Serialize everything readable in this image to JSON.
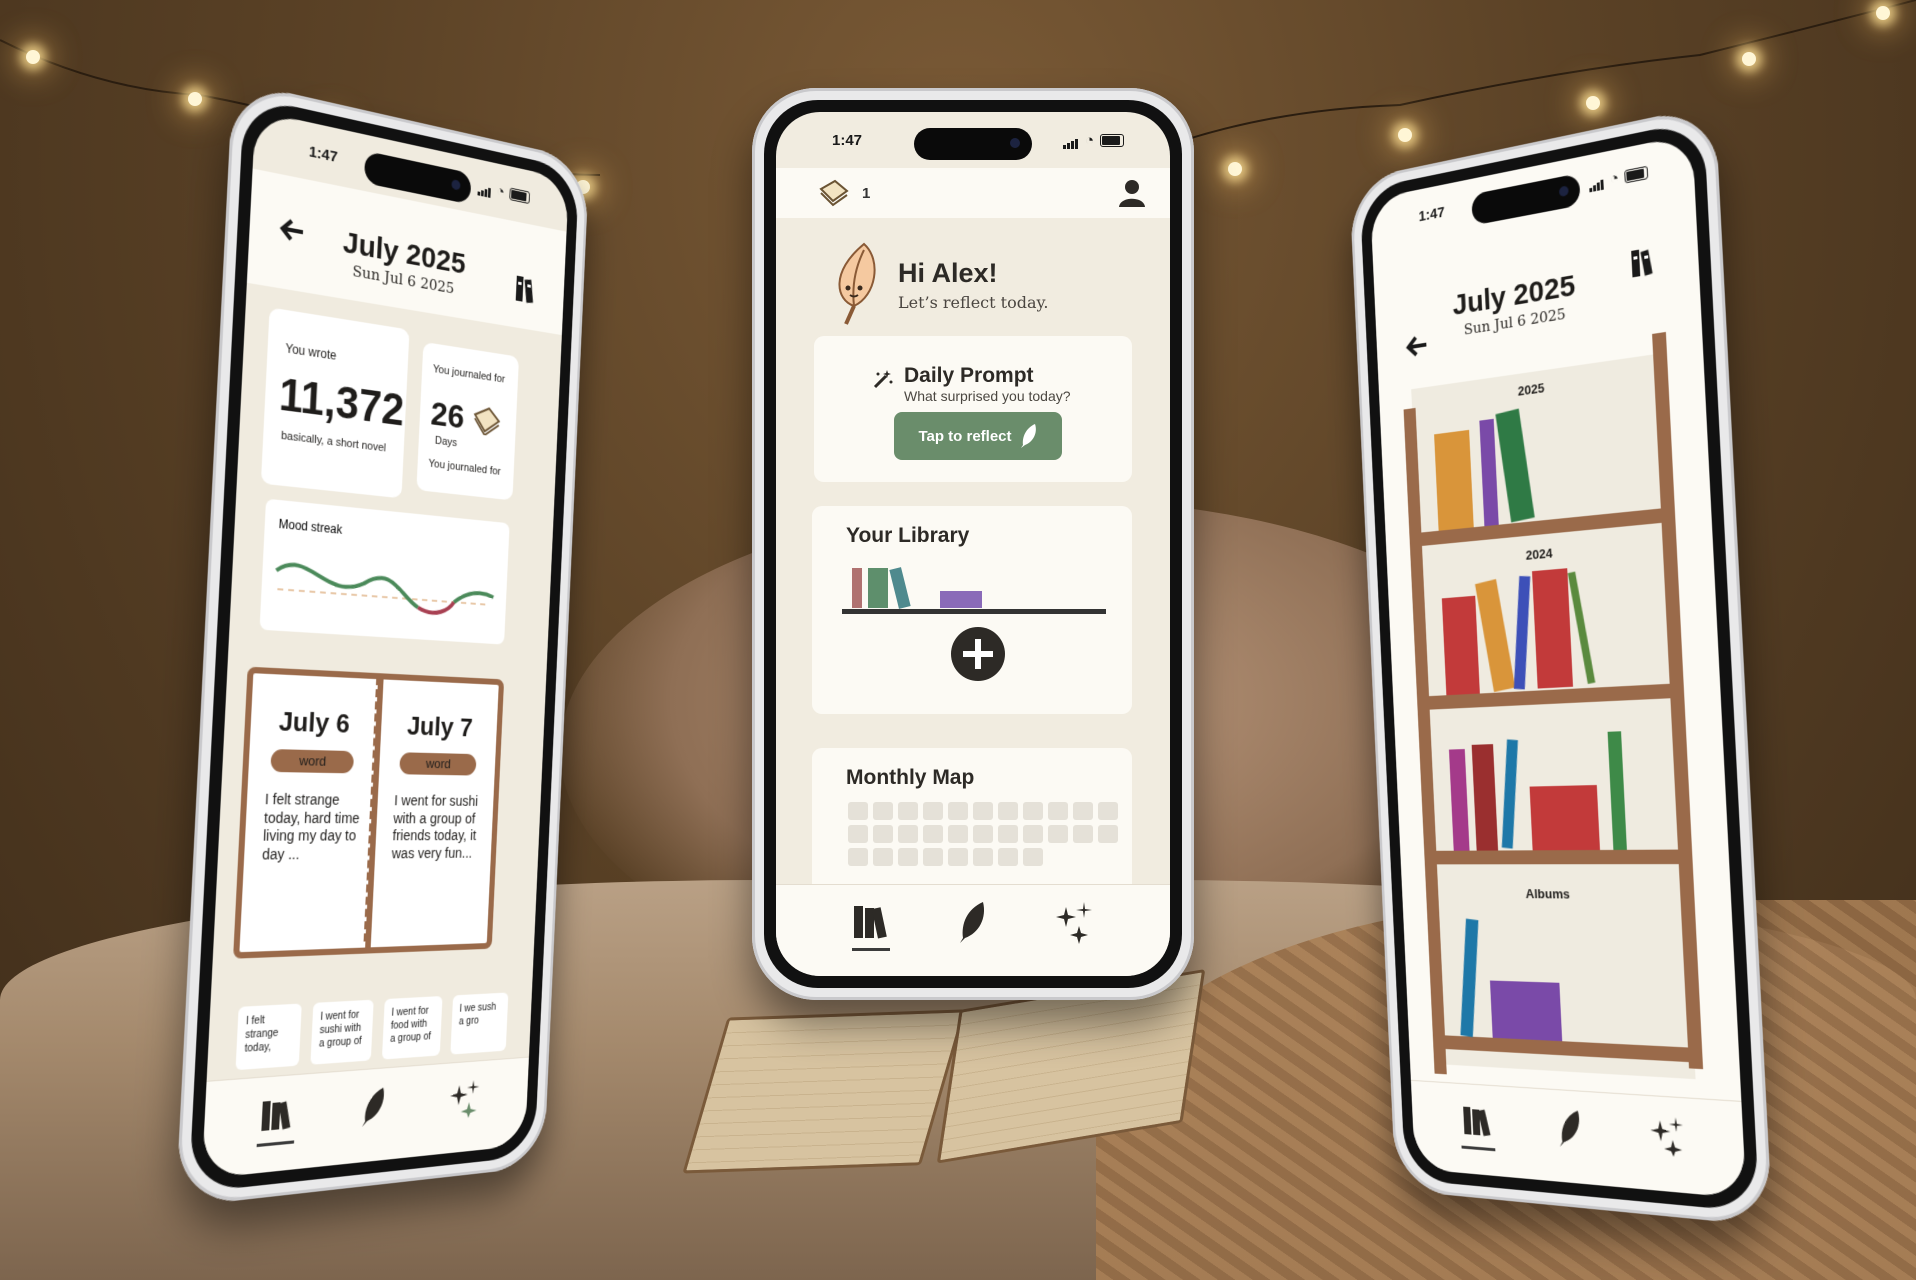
{
  "colors": {
    "accent_green": "#6a8d6b",
    "wood": "#9a6a4a",
    "cream": "#fcfaf4",
    "paper": "#f1ece0"
  },
  "status": {
    "time": "1:47"
  },
  "center": {
    "streak_count": "1",
    "greeting_title": "Hi Alex!",
    "greeting_sub": "Let’s reflect today.",
    "prompt_title": "Daily Prompt",
    "prompt_question": "What surprised you today?",
    "reflect_button": "Tap to reflect",
    "library_title": "Your Library",
    "map_title": "Monthly Map",
    "icons": [
      "journal-stack-icon",
      "profile-icon",
      "quill-mascot-icon",
      "magic-wand-icon",
      "feather-icon",
      "add-circle-icon"
    ]
  },
  "left": {
    "month": "July 2025",
    "date": "Sun Jul 6 2025",
    "you_wrote_label": "You wrote",
    "words_count": "11,372",
    "words_sub": "basically, a short novel",
    "journaled_label": "You journaled for",
    "days_count": "26",
    "days_unit": "Days",
    "journaled_label_2": "You journaled for",
    "mood_label": "Mood streak",
    "entries": [
      {
        "date": "July 6",
        "word": "word",
        "text": "I felt strange today, hard time living my day to day ..."
      },
      {
        "date": "July 7",
        "word": "word",
        "text": "I went for sushi with a group of friends today, it was very fun..."
      }
    ],
    "previews": [
      "I felt strange today,",
      "I went for sushi with a group of",
      "I went for food with a group of",
      "I we sush a gro"
    ]
  },
  "right": {
    "month": "July 2025",
    "date": "Sun Jul 6 2025",
    "shelves": [
      "2025",
      "2024",
      "",
      "Albums"
    ]
  },
  "tabs": [
    "library-tab",
    "write-tab",
    "insights-tab"
  ]
}
